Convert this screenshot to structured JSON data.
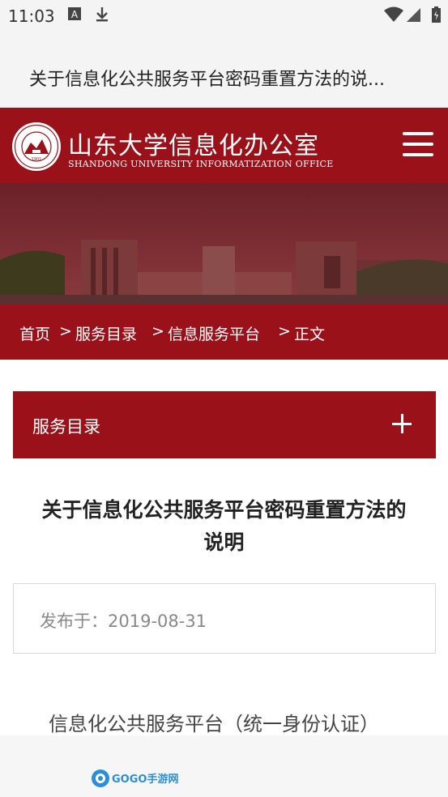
{
  "status_bar": {
    "time": "11:03",
    "icons": [
      "font-a-icon",
      "download-icon",
      "wifi-icon",
      "signal-icon",
      "battery-icon"
    ]
  },
  "page": {
    "title": "关于信息化公共服务平台密码重置方法的说..."
  },
  "header": {
    "logo_cn": "山东大学信息化办公室",
    "logo_en": "SHANDONG UNIVERSITY INFORMATIZATION OFFICE",
    "seal_year": "1901",
    "menu_icon": "hamburger-menu-icon"
  },
  "breadcrumb": {
    "items": [
      "首页",
      "服务目录",
      "信息服务平台",
      "正文"
    ],
    "separator": ">"
  },
  "category": {
    "label": "服务目录",
    "toggle_icon": "plus-icon"
  },
  "article": {
    "title_line1": "关于信息化公共服务平台密码重置方法的",
    "title_line2": "说明",
    "date": "发布于：2019-08-31",
    "body_first_line": "信息化公共服务平台（统一身份认证）"
  },
  "watermark": {
    "text": "GOGO手游网"
  },
  "colors": {
    "brand": "#9b1119",
    "text": "#222222",
    "muted": "#888888"
  }
}
